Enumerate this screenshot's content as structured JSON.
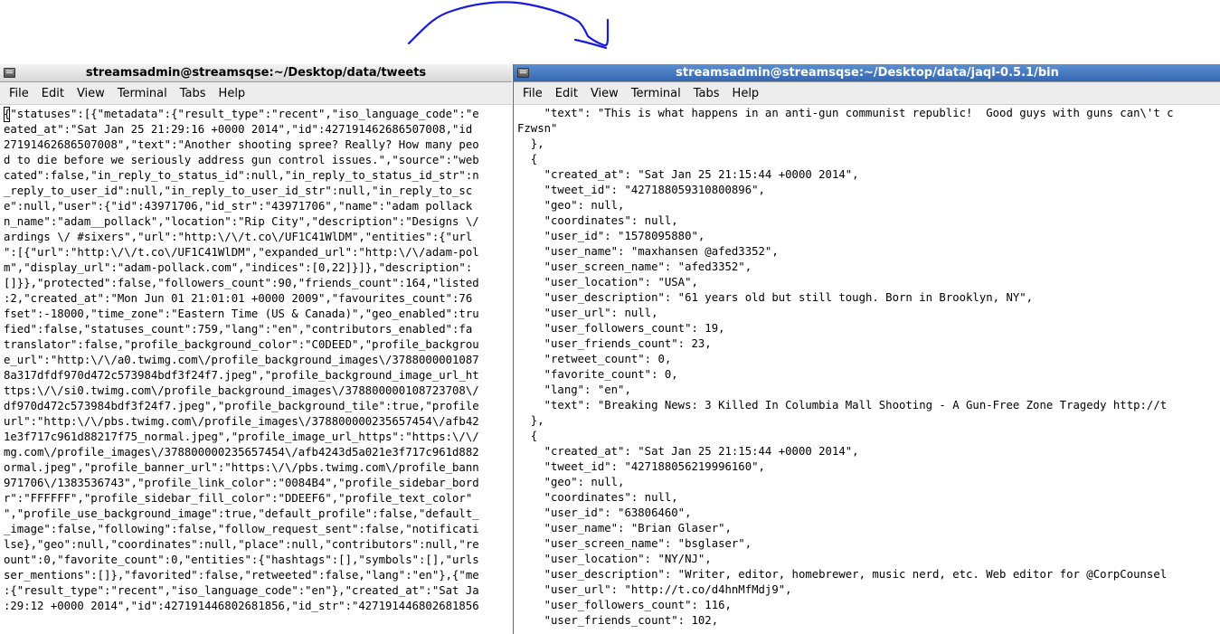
{
  "left_terminal": {
    "title": "streamsadmin@streamsqse:~/Desktop/data/tweets",
    "menu": [
      "File",
      "Edit",
      "View",
      "Terminal",
      "Tabs",
      "Help"
    ],
    "lines": [
      "{\"statuses\":[{\"metadata\":{\"result_type\":\"recent\",\"iso_language_code\":\"e",
      "eated_at\":\"Sat Jan 25 21:29:16 +0000 2014\",\"id\":427191462686507008,\"id",
      "27191462686507008\",\"text\":\"Another shooting spree? Really? How many peo",
      "d to die before we seriously address gun control issues.\",\"source\":\"web",
      "cated\":false,\"in_reply_to_status_id\":null,\"in_reply_to_status_id_str\":n",
      "_reply_to_user_id\":null,\"in_reply_to_user_id_str\":null,\"in_reply_to_sc",
      "e\":null,\"user\":{\"id\":43971706,\"id_str\":\"43971706\",\"name\":\"adam pollack",
      "n_name\":\"adam__pollack\",\"location\":\"Rip City\",\"description\":\"Designs \\/",
      "ardings \\/ #sixers\",\"url\":\"http:\\/\\/t.co\\/UF1C41WlDM\",\"entities\":{\"url",
      "\":[{\"url\":\"http:\\/\\/t.co\\/UF1C41WlDM\",\"expanded_url\":\"http:\\/\\/adam-pol",
      "m\",\"display_url\":\"adam-pollack.com\",\"indices\":[0,22]}]},\"description\":",
      "[]}},\"protected\":false,\"followers_count\":90,\"friends_count\":164,\"listed",
      ":2,\"created_at\":\"Mon Jun 01 21:01:01 +0000 2009\",\"favourites_count\":76",
      "fset\":-18000,\"time_zone\":\"Eastern Time (US & Canada)\",\"geo_enabled\":tru",
      "fied\":false,\"statuses_count\":759,\"lang\":\"en\",\"contributors_enabled\":fa",
      "translator\":false,\"profile_background_color\":\"C0DEED\",\"profile_backgrou",
      "e_url\":\"http:\\/\\/a0.twimg.com\\/profile_background_images\\/3788000001087",
      "8a317dfdf970d472c573984bdf3f24f7.jpeg\",\"profile_background_image_url_ht",
      "ttps:\\/\\/si0.twimg.com\\/profile_background_images\\/378800000108723708\\/",
      "df970d472c573984bdf3f24f7.jpeg\",\"profile_background_tile\":true,\"profile",
      "url\":\"http:\\/\\/pbs.twimg.com\\/profile_images\\/378800000235657454\\/afb42",
      "1e3f717c961d88217f75_normal.jpeg\",\"profile_image_url_https\":\"https:\\/\\/",
      "mg.com\\/profile_images\\/378800000235657454\\/afb4243d5a021e3f717c961d882",
      "ormal.jpeg\",\"profile_banner_url\":\"https:\\/\\/pbs.twimg.com\\/profile_bann",
      "971706\\/1383536743\",\"profile_link_color\":\"0084B4\",\"profile_sidebar_bord",
      "r\":\"FFFFFF\",\"profile_sidebar_fill_color\":\"DDEEF6\",\"profile_text_color\"",
      "\",\"profile_use_background_image\":true,\"default_profile\":false,\"default_",
      "_image\":false,\"following\":false,\"follow_request_sent\":false,\"notificati",
      "lse},\"geo\":null,\"coordinates\":null,\"place\":null,\"contributors\":null,\"re",
      "ount\":0,\"favorite_count\":0,\"entities\":{\"hashtags\":[],\"symbols\":[],\"urls",
      "ser_mentions\":[]},\"favorited\":false,\"retweeted\":false,\"lang\":\"en\"},{\"me",
      ":{\"result_type\":\"recent\",\"iso_language_code\":\"en\"},\"created_at\":\"Sat Ja",
      ":29:12 +0000 2014\",\"id\":427191446802681856,\"id_str\":\"427191446802681856"
    ]
  },
  "right_terminal": {
    "title": "streamsadmin@streamsqse:~/Desktop/data/jaql-0.5.1/bin",
    "menu": [
      "File",
      "Edit",
      "View",
      "Terminal",
      "Tabs",
      "Help"
    ],
    "lines": [
      "    \"text\": \"This is what happens in an anti-gun communist republic!  Good guys with guns can\\'t c",
      "Fzwsn\"",
      "  },",
      "  {",
      "    \"created_at\": \"Sat Jan 25 21:15:44 +0000 2014\",",
      "    \"tweet_id\": \"427188059310800896\",",
      "    \"geo\": null,",
      "    \"coordinates\": null,",
      "    \"user_id\": \"1578095880\",",
      "    \"user_name\": \"maxhansen @afed3352\",",
      "    \"user_screen_name\": \"afed3352\",",
      "    \"user_location\": \"USA\",",
      "    \"user_description\": \"61 years old but still tough. Born in Brooklyn, NY\",",
      "    \"user_url\": null,",
      "    \"user_followers_count\": 19,",
      "    \"user_friends_count\": 23,",
      "    \"retweet_count\": 0,",
      "    \"favorite_count\": 0,",
      "    \"lang\": \"en\",",
      "    \"text\": \"Breaking News: 3 Killed In Columbia Mall Shooting - A Gun-Free Zone Tragedy http://t",
      "  },",
      "  {",
      "    \"created_at\": \"Sat Jan 25 21:15:44 +0000 2014\",",
      "    \"tweet_id\": \"427188056219996160\",",
      "    \"geo\": null,",
      "    \"coordinates\": null,",
      "    \"user_id\": \"63806460\",",
      "    \"user_name\": \"Brian Glaser\",",
      "    \"user_screen_name\": \"bsglaser\",",
      "    \"user_location\": \"NY/NJ\",",
      "    \"user_description\": \"Writer, editor, homebrewer, music nerd, etc. Web editor for @CorpCounsel",
      "    \"user_url\": \"http://t.co/d4hnMfMdj9\",",
      "    \"user_followers_count\": 116,",
      "    \"user_friends_count\": 102,"
    ]
  },
  "colors": {
    "active_titlebar": "#3467b0",
    "inactive_titlebar": "#d7d7d7",
    "annotation_stroke": "#1a1adc"
  },
  "icons": [
    "terminal-window-icon",
    "hand-drawn-arrow"
  ]
}
